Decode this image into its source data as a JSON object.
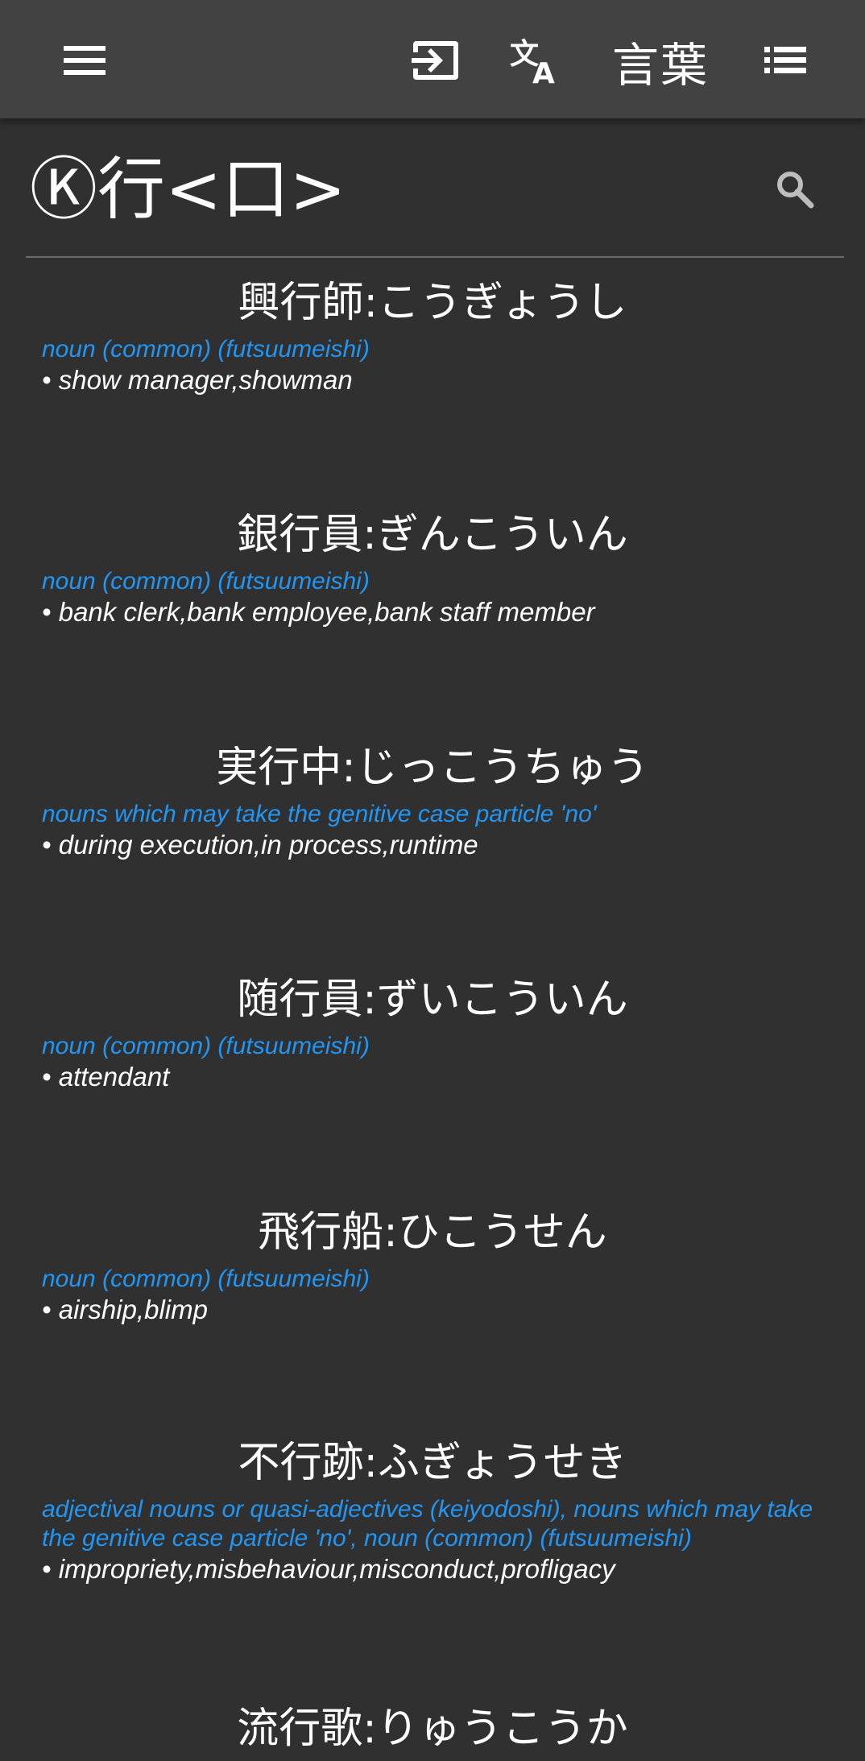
{
  "toolbar": {
    "menu_icon": "menu-icon",
    "login_icon": "login-icon",
    "translate_icon": "translate-icon",
    "kotoba_label": "言葉",
    "list_icon": "list-icon"
  },
  "header": {
    "title": "Ⓚ行<口>",
    "search_icon": "search-icon"
  },
  "entries": [
    {
      "headword": "興行師:こうぎょうし",
      "pos": "noun (common) (futsuumeishi)",
      "gloss": "• show manager,showman"
    },
    {
      "headword": "銀行員:ぎんこういん",
      "pos": "noun (common) (futsuumeishi)",
      "gloss": "• bank clerk,bank employee,bank staff member"
    },
    {
      "headword": "実行中:じっこうちゅう",
      "pos": "nouns which may take the genitive case particle 'no'",
      "gloss": "• during execution,in process,runtime"
    },
    {
      "headword": "随行員:ずいこういん",
      "pos": "noun (common) (futsuumeishi)",
      "gloss": "• attendant"
    },
    {
      "headword": "飛行船:ひこうせん",
      "pos": "noun (common) (futsuumeishi)",
      "gloss": "• airship,blimp"
    },
    {
      "headword": "不行跡:ふぎょうせき",
      "pos": "adjectival nouns or quasi-adjectives (keiyodoshi), nouns which may take the genitive case particle 'no', noun (common) (futsuumeishi)",
      "gloss": "• impropriety,misbehaviour,misconduct,profligacy"
    },
    {
      "headword": "流行歌:りゅうこうか",
      "pos": "",
      "gloss": ""
    }
  ],
  "colors": {
    "background": "#303030",
    "app_bar": "#424242",
    "pos_text": "#2196f3",
    "divider": "#6b6b6b"
  }
}
